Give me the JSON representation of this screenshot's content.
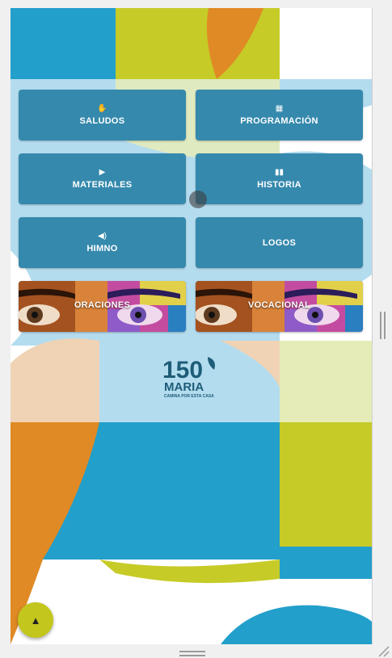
{
  "menu": {
    "buttons": [
      {
        "label": "SALUDOS",
        "icon": "hand-icon"
      },
      {
        "label": "PROGRAMACIÓN",
        "icon": "calendar-icon"
      },
      {
        "label": "MATERIALES",
        "icon": "play-icon"
      },
      {
        "label": "HISTORIA",
        "icon": "book-icon"
      },
      {
        "label": "HIMNO",
        "icon": "speaker-icon"
      },
      {
        "label": "LOGOS",
        "icon": ""
      }
    ],
    "image_buttons": [
      {
        "label": "ORACIONES"
      },
      {
        "label": "VOCACIONAL"
      }
    ]
  },
  "logo": {
    "text": "150 MARIA CAMINA POR ESTA CASA"
  },
  "scroll_top_button": {
    "icon": "arrow-up-icon"
  },
  "colors": {
    "button_blue": "#3589ad",
    "fab_yellow": "#c3c61c",
    "bg_blue": "#229fcb",
    "bg_yellow": "#c6cb27",
    "bg_orange": "#e08a25",
    "bg_light_blue": "#b4dcef",
    "bg_peach": "#f0d3b4",
    "bg_pale_yellow": "#e6ecb7"
  }
}
